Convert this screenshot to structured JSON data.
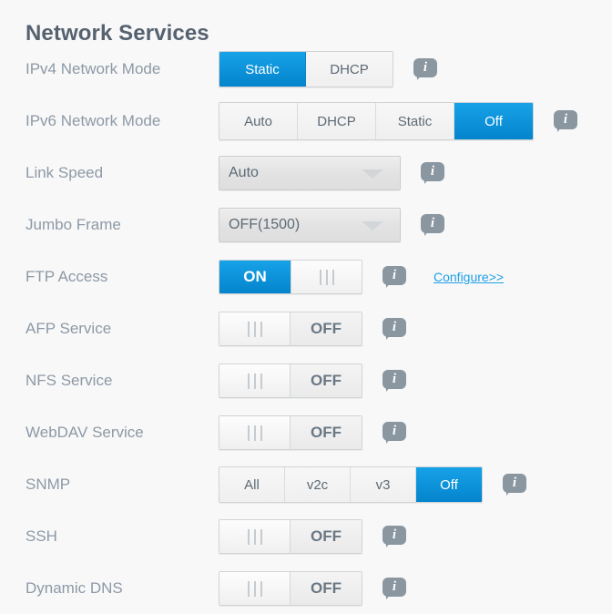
{
  "page": {
    "title": "Network Services",
    "accent_color": "#0d8fd8",
    "label_color": "#8d99a6",
    "link_color": "#1e9fe8",
    "background_color": "#f8f8f8"
  },
  "info_icon": {
    "name": "info-icon",
    "glyph": "i"
  },
  "rows": [
    {
      "label": "IPv4 Network Mode",
      "type": "segmented",
      "name": "ipv4-network-mode",
      "options": [
        "Static",
        "DHCP"
      ],
      "selected": "Static"
    },
    {
      "label": "IPv6 Network Mode",
      "type": "segmented",
      "name": "ipv6-network-mode",
      "options": [
        "Auto",
        "DHCP",
        "Static",
        "Off"
      ],
      "selected": "Off"
    },
    {
      "label": "Link Speed",
      "type": "dropdown",
      "name": "link-speed",
      "value": "Auto"
    },
    {
      "label": "Jumbo Frame",
      "type": "dropdown",
      "name": "jumbo-frame",
      "value": "OFF(1500)"
    },
    {
      "label": "FTP Access",
      "type": "toggle",
      "name": "ftp-access",
      "state": "ON",
      "state_label": "ON",
      "link": "Configure>>"
    },
    {
      "label": "AFP Service",
      "type": "toggle",
      "name": "afp-service",
      "state": "OFF",
      "state_label": "OFF"
    },
    {
      "label": "NFS Service",
      "type": "toggle",
      "name": "nfs-service",
      "state": "OFF",
      "state_label": "OFF"
    },
    {
      "label": "WebDAV Service",
      "type": "toggle",
      "name": "webdav-service",
      "state": "OFF",
      "state_label": "OFF"
    },
    {
      "label": "SNMP",
      "type": "segmented",
      "name": "snmp",
      "options": [
        "All",
        "v2c",
        "v3",
        "Off"
      ],
      "selected": "Off"
    },
    {
      "label": "SSH",
      "type": "toggle",
      "name": "ssh",
      "state": "OFF",
      "state_label": "OFF"
    },
    {
      "label": "Dynamic DNS",
      "type": "toggle",
      "name": "dynamic-dns",
      "state": "OFF",
      "state_label": "OFF"
    }
  ]
}
